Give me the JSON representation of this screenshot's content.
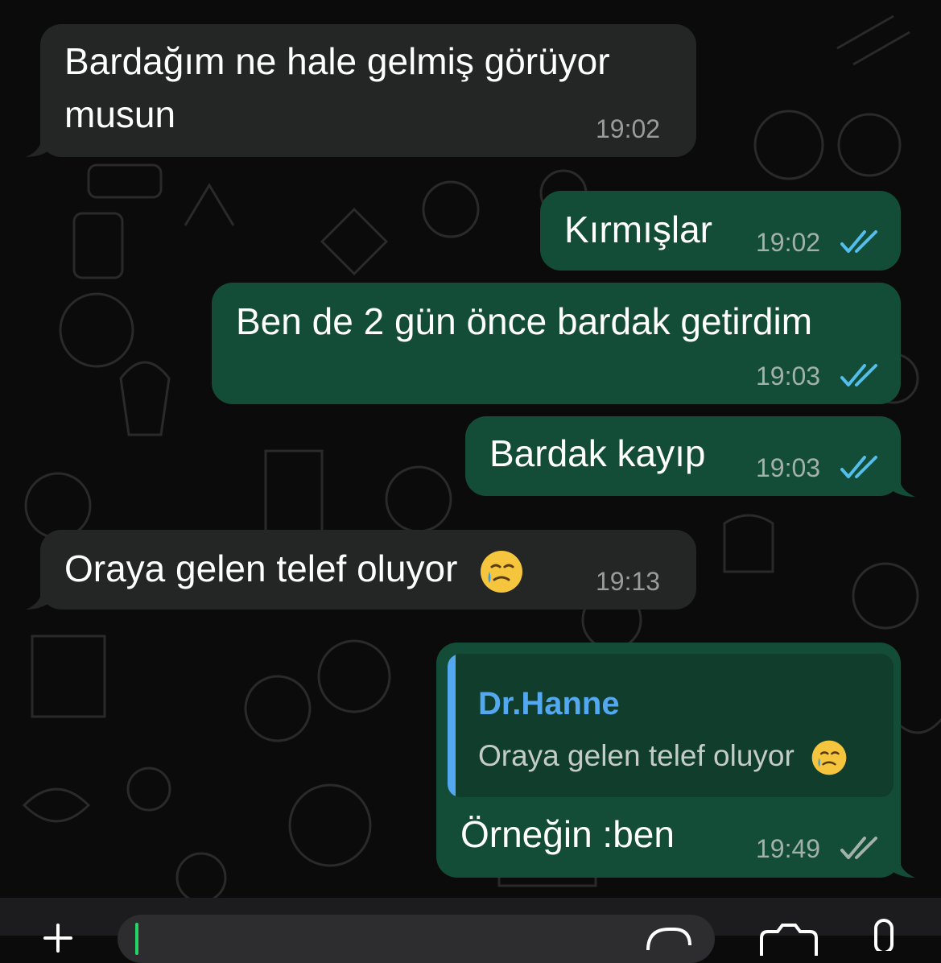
{
  "chat": {
    "messages": [
      {
        "direction": "incoming",
        "lines": [
          "Bardağım ne hale gelmiş görüyor",
          "musun"
        ],
        "time": "19:02"
      },
      {
        "direction": "outgoing",
        "text": "Kırmışlar",
        "time": "19:02",
        "status": "read"
      },
      {
        "direction": "outgoing",
        "text": "Ben de 2 gün önce bardak getirdim",
        "time": "19:03",
        "status": "read"
      },
      {
        "direction": "outgoing",
        "text": "Bardak kayıp",
        "time": "19:03",
        "status": "read"
      },
      {
        "direction": "incoming",
        "text": "Oraya gelen telef oluyor",
        "emoji": "face-holding-back-tears",
        "time": "19:13"
      },
      {
        "direction": "outgoing",
        "reply_to": {
          "author": "Dr.Hanne",
          "text": "Oraya gelen telef oluyor",
          "emoji": "face-holding-back-tears"
        },
        "text": "Örneğin :ben",
        "time": "19:49",
        "status": "delivered"
      }
    ]
  },
  "colors": {
    "incoming_bubble": "#232625",
    "outgoing_bubble": "#144d37",
    "read_ticks": "#53bdeb",
    "delivered_ticks": "#a3b1ab",
    "quote_accent": "#53a8f0",
    "background": "#0b0b0b"
  },
  "icons": [
    "double-check-icon",
    "crying-smile-emoji",
    "plus-icon",
    "sticker-icon",
    "camera-icon",
    "microphone-icon"
  ]
}
